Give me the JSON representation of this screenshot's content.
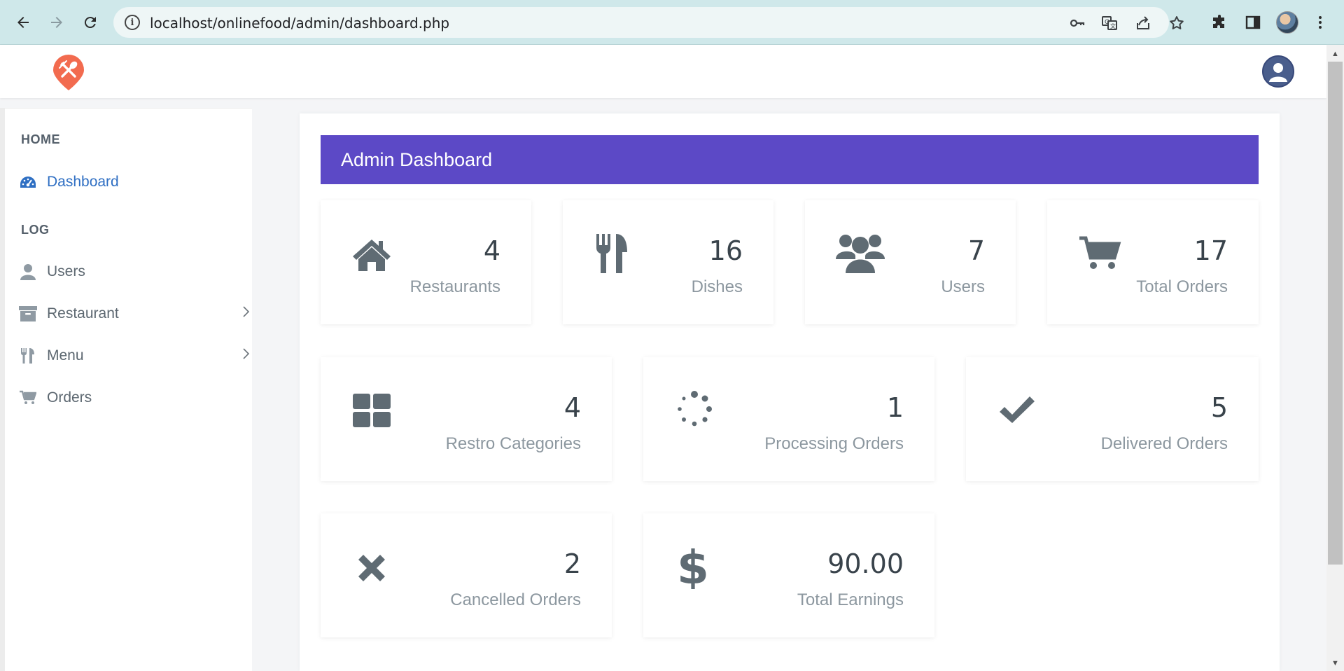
{
  "browser": {
    "url": "localhost/onlinefood/admin/dashboard.php",
    "info_glyph": "i"
  },
  "sidebar": {
    "sections": [
      {
        "heading": "HOME"
      },
      {
        "heading": "LOG"
      }
    ],
    "items": [
      {
        "label": "Dashboard",
        "icon": "dashboard-icon",
        "active": true
      },
      {
        "label": "Users",
        "icon": "user-icon"
      },
      {
        "label": "Restaurant",
        "icon": "archive-icon",
        "has_submenu": true
      },
      {
        "label": "Menu",
        "icon": "cutlery-icon",
        "has_submenu": true
      },
      {
        "label": "Orders",
        "icon": "cart-icon"
      }
    ]
  },
  "main": {
    "title": "Admin Dashboard",
    "stats": [
      {
        "value": "4",
        "label": "Restaurants",
        "icon": "home-icon"
      },
      {
        "value": "16",
        "label": "Dishes",
        "icon": "cutlery-icon"
      },
      {
        "value": "7",
        "label": "Users",
        "icon": "users-icon"
      },
      {
        "value": "17",
        "label": "Total Orders",
        "icon": "cart-icon"
      },
      {
        "value": "4",
        "label": "Restro Categories",
        "icon": "grid-icon"
      },
      {
        "value": "1",
        "label": "Processing Orders",
        "icon": "spinner-icon"
      },
      {
        "value": "5",
        "label": "Delivered Orders",
        "icon": "check-icon"
      },
      {
        "value": "2",
        "label": "Cancelled Orders",
        "icon": "close-icon"
      },
      {
        "value": "90.00",
        "label": "Total Earnings",
        "icon": "dollar-icon"
      }
    ]
  },
  "colors": {
    "banner": "#5c49c6",
    "logo": "#f26b4f",
    "active_link": "#2f6fc3",
    "icon_gray": "#5f6b73"
  }
}
